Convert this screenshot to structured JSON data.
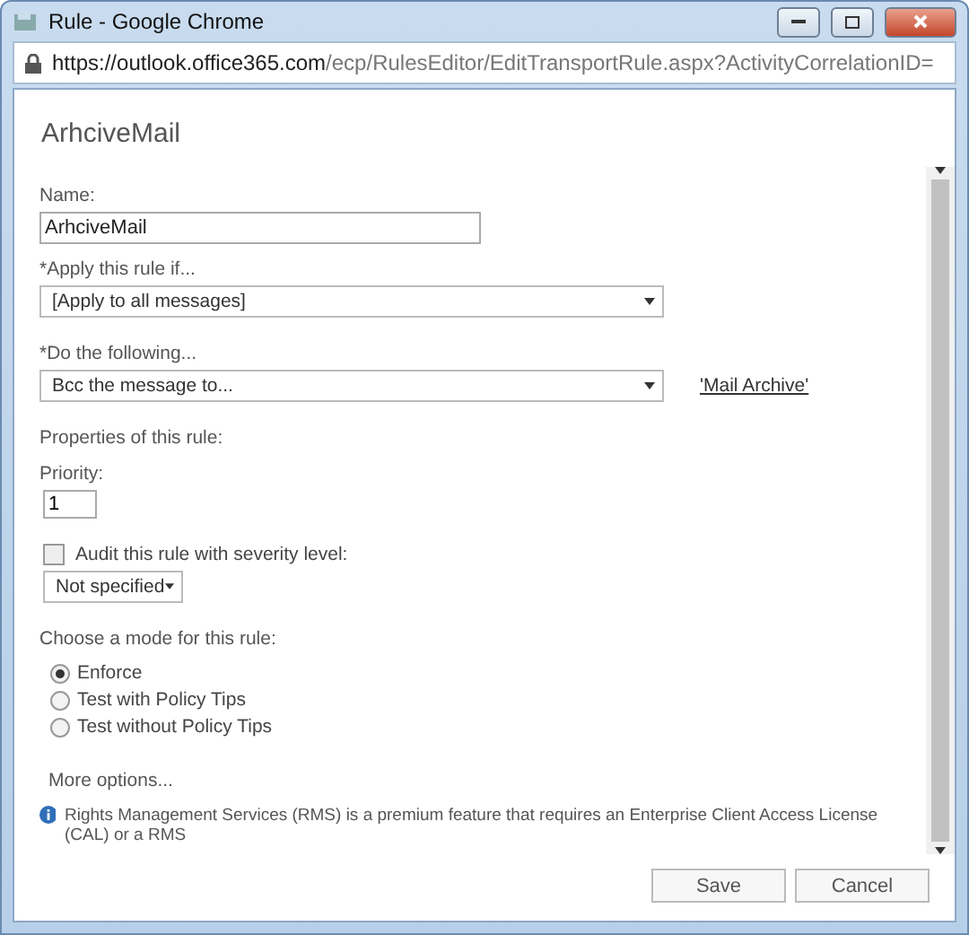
{
  "window": {
    "title": "Rule - Google Chrome"
  },
  "address_bar": {
    "url_host": "https://outlook.office365.com",
    "url_path": "/ecp/RulesEditor/EditTransportRule.aspx?ActivityCorrelationID="
  },
  "heading": "ArhciveMail",
  "form": {
    "name_label": "Name:",
    "name_value": "ArhciveMail",
    "condition_label": "*Apply this rule if...",
    "condition_value": "[Apply to all messages]",
    "action_label": "*Do the following...",
    "action_value": "Bcc the message to...",
    "action_link": "'Mail Archive'",
    "properties_label": "Properties of this rule:",
    "priority_label": "Priority:",
    "priority_value": "1",
    "audit": {
      "label": "Audit this rule with severity level:",
      "checked": false
    },
    "severity_value": "Not specified",
    "mode_label": "Choose a mode for this rule:",
    "modes": [
      {
        "label": "Enforce",
        "selected": true
      },
      {
        "label": "Test with Policy Tips",
        "selected": false
      },
      {
        "label": "Test without Policy Tips",
        "selected": false
      }
    ],
    "more_options": "More options..."
  },
  "info": "Rights Management Services (RMS) is a premium feature that requires an Enterprise Client Access License (CAL) or a RMS",
  "buttons": [
    "Save",
    "Cancel"
  ]
}
